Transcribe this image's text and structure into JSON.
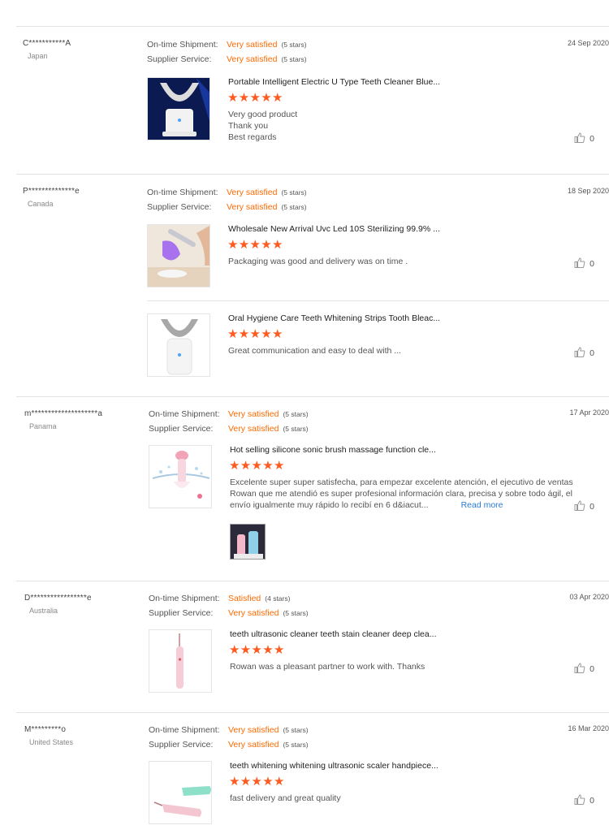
{
  "labels": {
    "shipment": "On-time Shipment:",
    "service": "Supplier Service:"
  },
  "colors": {
    "accent": "#ff6a00",
    "link": "#2a7bd0"
  },
  "reviews": [
    {
      "user": "C***********A",
      "country": "Japan",
      "date": "24 Sep 2020",
      "shipment": {
        "value": "Very satisfied",
        "stars": "(5 stars)"
      },
      "service": {
        "value": "Very satisfied",
        "stars": "(5 stars)"
      },
      "products": [
        {
          "title": "Portable Intelligent Electric U Type Teeth Cleaner Blue...",
          "stars": "★★★★★",
          "comment": [
            "Very good product",
            "Thank you",
            "Best regards"
          ],
          "likes": "0"
        }
      ]
    },
    {
      "user": "P**************e",
      "country": "Canada",
      "date": "18 Sep 2020",
      "shipment": {
        "value": "Very satisfied",
        "stars": "(5 stars)"
      },
      "service": {
        "value": "Very satisfied",
        "stars": "(5 stars)"
      },
      "products": [
        {
          "title": "Wholesale New Arrival Uvc Led 10S Sterilizing 99.9% ...",
          "stars": "★★★★★",
          "comment": [
            "Packaging was good and delivery was on time ."
          ],
          "likes": "0"
        },
        {
          "title": "Oral Hygiene Care Teeth Whitening Strips Tooth Bleac...",
          "stars": "★★★★★",
          "comment": [
            "Great communication and easy to deal with ..."
          ],
          "likes": "0"
        }
      ]
    },
    {
      "user": "m********************a",
      "country": "Panama",
      "date": "17 Apr 2020",
      "shipment": {
        "value": "Very satisfied",
        "stars": "(5 stars)"
      },
      "service": {
        "value": "Very satisfied",
        "stars": "(5 stars)"
      },
      "products": [
        {
          "title": "Hot selling silicone sonic brush massage function cle...",
          "stars": "★★★★★",
          "comment": [
            "Excelente super super satisfecha, para empezar excelente atención, el ejecutivo de ventas",
            "Rowan que me atendió es super profesional información clara, precisa y sobre todo ágil, el",
            "envío igualmente muy rápido lo recibí en 6 d&iacut..."
          ],
          "read_more": "Read more",
          "likes": "0"
        }
      ]
    },
    {
      "user": "D*****************e",
      "country": "Australia",
      "date": "03 Apr 2020",
      "shipment": {
        "value": "Satisfied",
        "stars": "(4 stars)"
      },
      "service": {
        "value": "Very satisfied",
        "stars": "(5 stars)"
      },
      "products": [
        {
          "title": "teeth ultrasonic cleaner teeth stain cleaner deep clea...",
          "stars": "★★★★★",
          "comment": [
            "Rowan was a pleasant partner to work with. Thanks"
          ],
          "likes": "0"
        }
      ]
    },
    {
      "user": "M*********o",
      "country": "United States",
      "date": "16 Mar 2020",
      "shipment": {
        "value": "Very satisfied",
        "stars": "(5 stars)"
      },
      "service": {
        "value": "Very satisfied",
        "stars": "(5 stars)"
      },
      "products": [
        {
          "title": "teeth whitening whitening ultrasonic scaler handpiece...",
          "stars": "★★★★★",
          "comment": [
            "fast delivery and great quality"
          ],
          "likes": "0"
        }
      ]
    }
  ]
}
